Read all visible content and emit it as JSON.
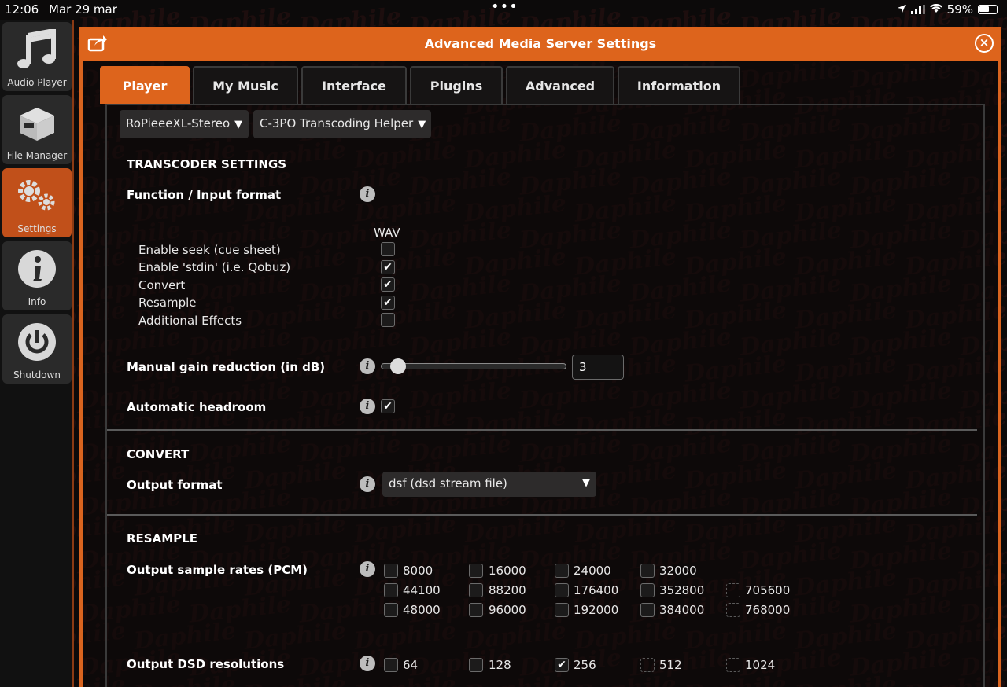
{
  "status": {
    "time": "12:06",
    "date": "Mar 29 mar",
    "battery": "59%"
  },
  "sidebar": {
    "items": [
      {
        "label": "Audio Player",
        "icon": "music-note-icon"
      },
      {
        "label": "File Manager",
        "icon": "box-icon"
      },
      {
        "label": "Settings",
        "icon": "gears-icon",
        "active": true
      },
      {
        "label": "Info",
        "icon": "info-icon"
      },
      {
        "label": "Shutdown",
        "icon": "power-icon"
      }
    ]
  },
  "dialog": {
    "title": "Advanced Media Server Settings",
    "accent_color": "#dd641c"
  },
  "tabs": [
    {
      "label": "Player",
      "active": true
    },
    {
      "label": "My Music"
    },
    {
      "label": "Interface"
    },
    {
      "label": "Plugins"
    },
    {
      "label": "Advanced"
    },
    {
      "label": "Information"
    }
  ],
  "selectors": {
    "player": "RoPieeeXL-Stereo",
    "plugin": "C-3PO Transcoding Helper"
  },
  "transcoder": {
    "heading": "TRANSCODER SETTINGS",
    "function_label": "Function / Input format",
    "column_header": "WAV",
    "options": [
      {
        "label": "Enable seek (cue sheet)",
        "checked": false
      },
      {
        "label": "Enable 'stdin' (i.e. Qobuz)",
        "checked": true
      },
      {
        "label": "Convert",
        "checked": true
      },
      {
        "label": "Resample",
        "checked": true
      },
      {
        "label": "Additional Effects",
        "checked": false
      }
    ],
    "gain_label": "Manual gain reduction (in dB)",
    "gain_value": "3",
    "headroom_label": "Automatic headroom",
    "headroom_checked": true
  },
  "convert": {
    "heading": "CONVERT",
    "output_format_label": "Output format",
    "output_format_value": "dsf (dsd stream file)"
  },
  "resample": {
    "heading": "RESAMPLE",
    "pcm_label": "Output sample rates (PCM)",
    "pcm_rates": [
      [
        "8000",
        "16000",
        "24000",
        "32000",
        ""
      ],
      [
        "44100",
        "88200",
        "176400",
        "352800",
        "705600"
      ],
      [
        "48000",
        "96000",
        "192000",
        "384000",
        "768000"
      ]
    ],
    "dsd_label": "Output DSD resolutions",
    "dsd_rates": [
      "64",
      "128",
      "256",
      "512",
      "1024"
    ]
  }
}
